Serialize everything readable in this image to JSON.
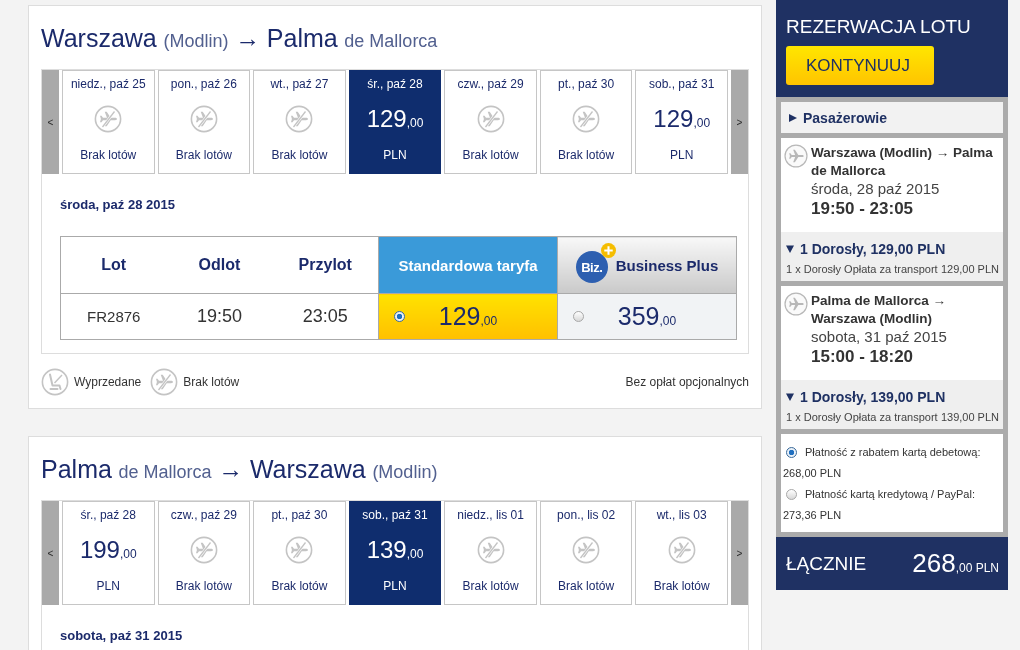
{
  "outbound": {
    "title": [
      {
        "text": "Warszawa",
        "kind": "main"
      },
      {
        "text": "(Modlin)",
        "kind": "sub"
      },
      {
        "text": "→",
        "kind": "main"
      },
      {
        "text": "Palma",
        "kind": "main"
      },
      {
        "text": "de Mallorca",
        "kind": "sub"
      }
    ],
    "prev": "<",
    "next": ">",
    "days": [
      {
        "date": "niedz., paź 25",
        "kind": "none",
        "label": "Brak lotów",
        "selected": false
      },
      {
        "date": "pon., paź 26",
        "kind": "none",
        "label": "Brak lotów",
        "selected": false
      },
      {
        "date": "wt., paź 27",
        "kind": "none",
        "label": "Brak lotów",
        "selected": false
      },
      {
        "date": "śr., paź 28",
        "kind": "price",
        "price": "129",
        "decimals": ",00",
        "currency": "PLN",
        "selected": true
      },
      {
        "date": "czw., paź 29",
        "kind": "none",
        "label": "Brak lotów",
        "selected": false
      },
      {
        "date": "pt., paź 30",
        "kind": "none",
        "label": "Brak lotów",
        "selected": false
      },
      {
        "date": "sob., paź 31",
        "kind": "price",
        "price": "129",
        "decimals": ",00",
        "currency": "PLN",
        "selected": false
      }
    ],
    "day_heading": "środa, paź 28 2015",
    "table": {
      "columns": [
        "Lot",
        "Odlot",
        "Przylot"
      ],
      "fare_columns": [
        {
          "label": "Standardowa taryfa",
          "kind": "standard"
        },
        {
          "label": "Business Plus",
          "kind": "business",
          "badge": "Biz."
        }
      ],
      "rows": [
        {
          "flight": "FR2876",
          "departure": "19:50",
          "arrival": "23:05",
          "fares": [
            {
              "price": "129",
              "decimals": ",00",
              "selected": true
            },
            {
              "price": "359",
              "decimals": ",00",
              "selected": false
            }
          ]
        }
      ]
    },
    "legend": [
      {
        "kind": "sold_out",
        "label": "Wyprzedane"
      },
      {
        "kind": "no_flights",
        "label": "Brak lotów"
      }
    ],
    "note": "Bez opłat opcjonalnych"
  },
  "inbound": {
    "title": [
      {
        "text": "Palma",
        "kind": "main"
      },
      {
        "text": "de Mallorca",
        "kind": "sub"
      },
      {
        "text": "→",
        "kind": "main"
      },
      {
        "text": "Warszawa",
        "kind": "main"
      },
      {
        "text": "(Modlin)",
        "kind": "sub"
      }
    ],
    "prev": "<",
    "next": ">",
    "days": [
      {
        "date": "śr., paź 28",
        "kind": "price",
        "price": "199",
        "decimals": ",00",
        "currency": "PLN",
        "selected": false
      },
      {
        "date": "czw., paź 29",
        "kind": "none",
        "label": "Brak lotów",
        "selected": false
      },
      {
        "date": "pt., paź 30",
        "kind": "none",
        "label": "Brak lotów",
        "selected": false
      },
      {
        "date": "sob., paź 31",
        "kind": "price",
        "price": "139",
        "decimals": ",00",
        "currency": "PLN",
        "selected": true
      },
      {
        "date": "niedz., lis 01",
        "kind": "none",
        "label": "Brak lotów",
        "selected": false
      },
      {
        "date": "pon., lis 02",
        "kind": "none",
        "label": "Brak lotów",
        "selected": false
      },
      {
        "date": "wt., lis 03",
        "kind": "none",
        "label": "Brak lotów",
        "selected": false
      }
    ],
    "day_heading": "sobota, paź 31 2015"
  },
  "booking": {
    "title": "REZERWACJA LOTU",
    "continue": "KONTYNUUJ",
    "passengers": {
      "label": "Pasażerowie",
      "expanded": false
    },
    "flights": [
      {
        "route": "Warszawa (Modlin) → Palma de Mallorca",
        "date": "środa, 28 paź 2015",
        "time": "19:50 - 23:05",
        "fare": {
          "summary": "1 Dorosły, 129,00 PLN",
          "expanded": true,
          "lines": [
            {
              "label": "1 x Dorosły Opłata za transport",
              "amount": "129,00 PLN"
            }
          ]
        }
      },
      {
        "route": "Palma de Mallorca → Warszawa (Modlin)",
        "date": "sobota, 31 paź 2015",
        "time": "15:00 - 18:20",
        "fare": {
          "summary": "1 Dorosły, 139,00 PLN",
          "expanded": true,
          "lines": [
            {
              "label": "1 x Dorosły Opłata za transport",
              "amount": "139,00 PLN"
            }
          ]
        }
      }
    ],
    "payment": [
      {
        "label": "Płatność z rabatem kartą debetową:",
        "amount": "268,00 PLN",
        "selected": true
      },
      {
        "label": "Płatność kartą kredytową / PayPal:",
        "amount": "273,36 PLN",
        "selected": false
      }
    ],
    "total": {
      "label": "ŁĄCZNIE",
      "amount": "268",
      "decimals": ",00",
      "currency": "PLN"
    }
  }
}
